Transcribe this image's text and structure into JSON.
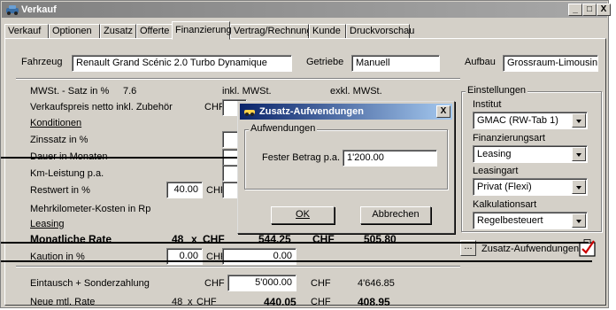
{
  "window": {
    "title": "Verkauf",
    "minimize": "_",
    "maximize": "□",
    "close": "X"
  },
  "tabs": [
    "Verkauf",
    "Optionen",
    "Zusatz",
    "Offerte",
    "Finanzierung",
    "Vertrag/Rechnung",
    "Kunde",
    "Druckvorschau"
  ],
  "vehicle": {
    "fahrzeug_label": "Fahrzeug",
    "fahrzeug_value": "Renault Grand Scénic 2.0 Turbo Dynamique",
    "getriebe_label": "Getriebe",
    "getriebe_value": "Manuell",
    "aufbau_label": "Aufbau",
    "aufbau_value": "Grossraum-Limousine"
  },
  "calc": {
    "mwst_label": "MWSt. - Satz in %",
    "mwst_value": "7.6",
    "inkl_mwst": "inkl. MWSt.",
    "exkl_mwst": "exkl. MWSt.",
    "verkaufspreis_label": "Verkaufspreis netto inkl. Zubehör",
    "chf": "CHF",
    "konditionen": "Konditionen",
    "zinssatz_label": "Zinssatz in %",
    "dauer_label": "Dauer in Monaten",
    "km_label": "Km-Leistung p.a.",
    "restwert_label": "Restwert in %",
    "restwert_value": "40.00",
    "mehrkm_label": "Mehrkilometer-Kosten in Rp",
    "leasing": "Leasing",
    "monatliche_rate_label": "Monatliche Rate",
    "monatliche_months": "48",
    "x": "x",
    "monatliche_inkl": "544.25",
    "monatliche_exkl": "505.80",
    "kaution_label": "Kaution in %",
    "kaution_pct": "0.00",
    "kaution_chf": "0.00",
    "eintausch_label": "Eintausch + Sonderzahlung",
    "eintausch_inkl": "5'000.00",
    "eintausch_exkl": "4'646.85",
    "neue_rate_label": "Neue mtl. Rate",
    "neue_months": "48",
    "neue_inkl": "440.05",
    "neue_exkl": "408.95"
  },
  "settings": {
    "group_title": "Einstellungen",
    "institut_label": "Institut",
    "institut_value": "GMAC (RW-Tab 1)",
    "finanzierungsart_label": "Finanzierungsart",
    "finanzierungsart_value": "Leasing",
    "leasingart_label": "Leasingart",
    "leasingart_value": "Privat (Flexi)",
    "kalkulationsart_label": "Kalkulationsart",
    "kalkulationsart_value": "Regelbesteuert"
  },
  "zusatz_button": {
    "ellipsis": "...",
    "label": "Zusatz-Aufwendungen"
  },
  "dialog": {
    "title": "Zusatz-Aufwendungen",
    "close": "X",
    "group_title": "Aufwendungen",
    "fester_label": "Fester Betrag p.a.",
    "fester_value": "1'200.00",
    "ok": "OK",
    "abbrechen": "Abbrechen"
  },
  "colors": {
    "accent_check": "#cc0000",
    "dialog_title": "#0a246a"
  }
}
